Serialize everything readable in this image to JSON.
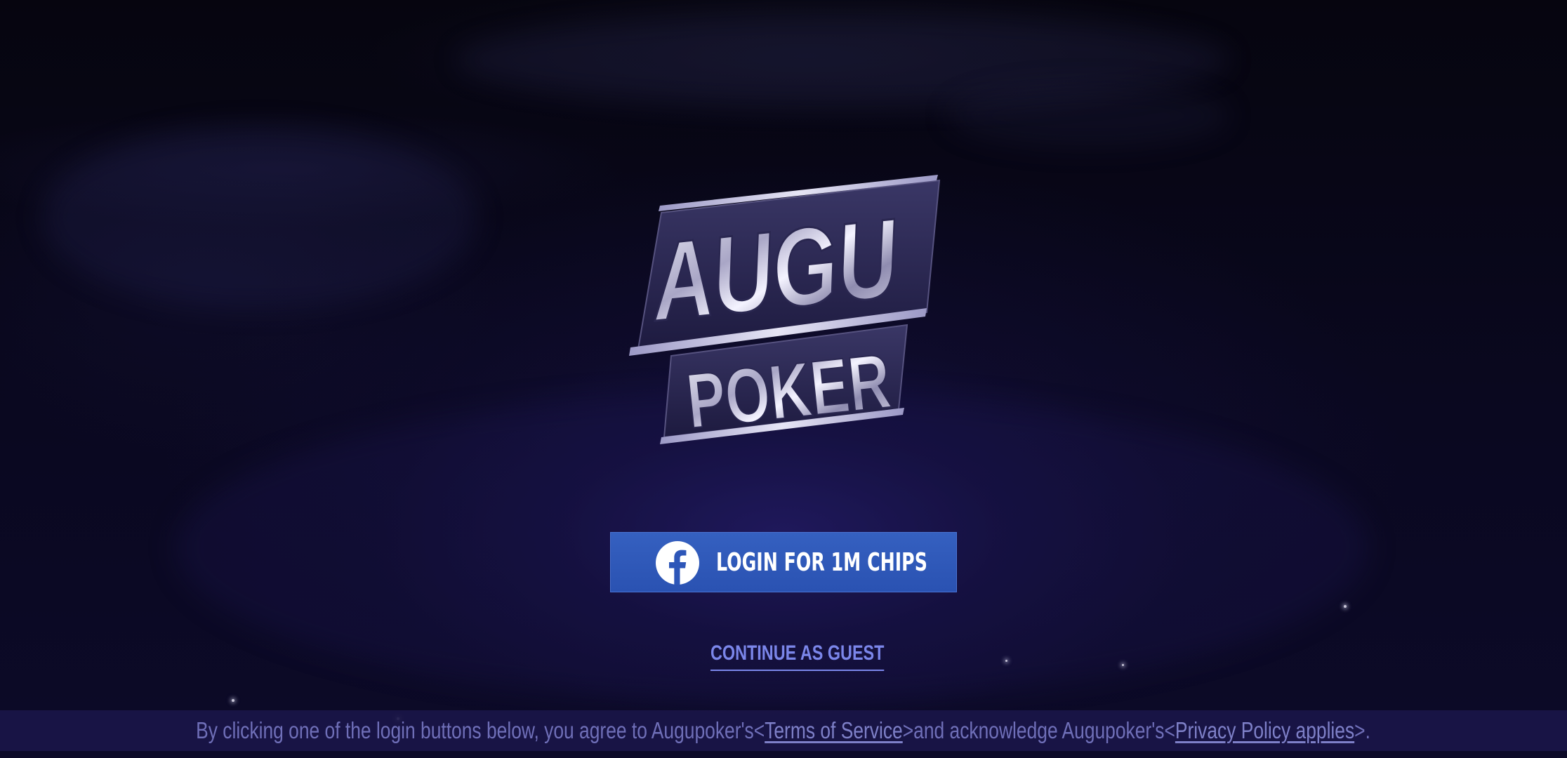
{
  "logo": {
    "line1": "AUGU",
    "line2": "POKER"
  },
  "login_button": {
    "label": "LOGIN FOR 1M CHIPS",
    "icon": "facebook-icon",
    "color": "#2d56b8"
  },
  "guest": {
    "label": "CONTINUE AS GUEST",
    "color": "#7b86ea"
  },
  "footer": {
    "prefix": "By clicking one of the login buttons below, you agree to Augupoker's<",
    "terms_label": "Terms of Service",
    "middle": ">and acknowledge Augupoker's<",
    "privacy_label": "Privacy Policy applies",
    "suffix": ">."
  },
  "colors": {
    "background": "#06050f",
    "footer_bar": "#1a1648"
  }
}
